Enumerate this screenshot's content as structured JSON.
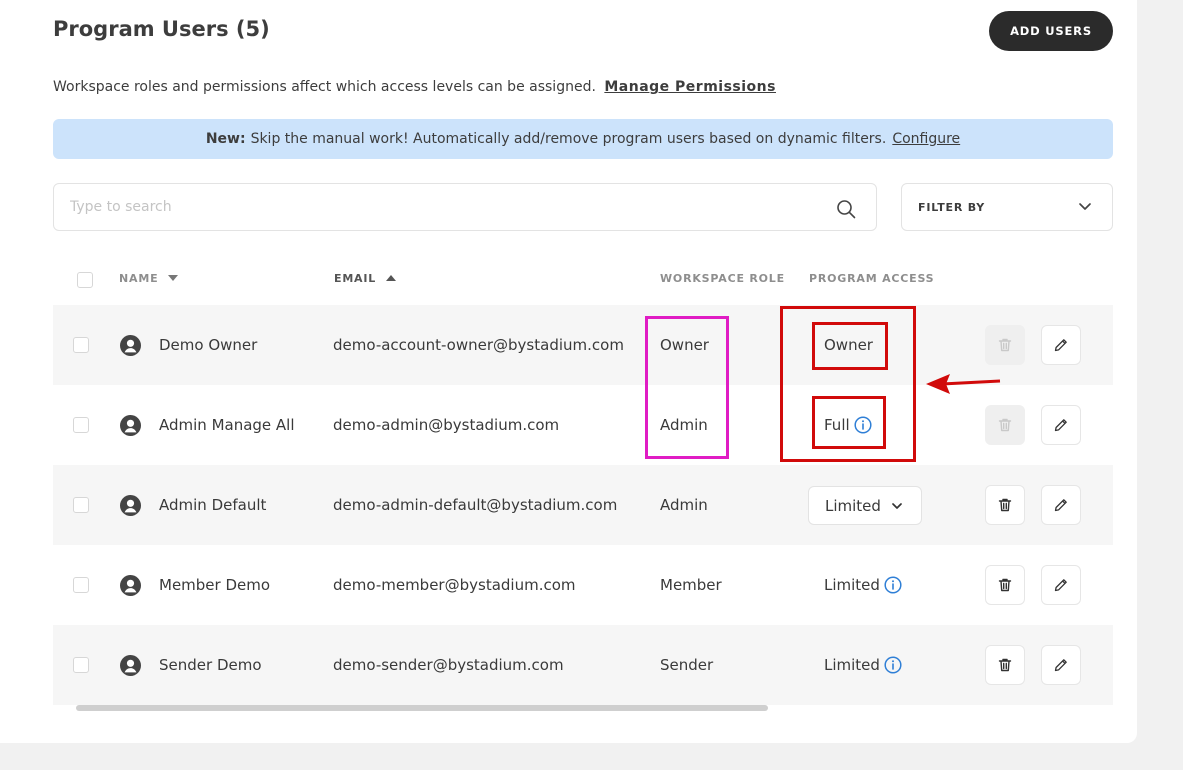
{
  "header": {
    "title": "Program Users (5)",
    "add_button": "ADD USERS"
  },
  "permissions": {
    "text": "Workspace roles and permissions affect which access levels can be assigned.",
    "link": "Manage Permissions"
  },
  "banner": {
    "bold": "New:",
    "text": "Skip the manual work! Automatically add/remove program users based on dynamic filters.",
    "link": "Configure",
    "color": "#cce3fb"
  },
  "search": {
    "placeholder": "Type to search",
    "value": ""
  },
  "filter": {
    "label": "FILTER BY"
  },
  "table": {
    "headers": {
      "name": "NAME",
      "email": "EMAIL",
      "workspace_role": "WORKSPACE ROLE",
      "program_access": "PROGRAM ACCESS"
    },
    "rows": [
      {
        "name": "Demo Owner",
        "email": "demo-account-owner@bystadium.com",
        "role": "Owner",
        "access": "Owner"
      },
      {
        "name": "Admin Manage All",
        "email": "demo-admin@bystadium.com",
        "role": "Admin",
        "access": "Full"
      },
      {
        "name": "Admin Default",
        "email": "demo-admin-default@bystadium.com",
        "role": "Admin",
        "access": "Limited"
      },
      {
        "name": "Member Demo",
        "email": "demo-member@bystadium.com",
        "role": "Member",
        "access": "Limited"
      },
      {
        "name": "Sender Demo",
        "email": "demo-sender@bystadium.com",
        "role": "Sender",
        "access": "Limited"
      }
    ]
  },
  "colors": {
    "accent_dark": "#2b2b2b",
    "info_blue": "#2f7fd6",
    "annotation_magenta": "#e01cc4",
    "annotation_red": "#d10a0a"
  }
}
